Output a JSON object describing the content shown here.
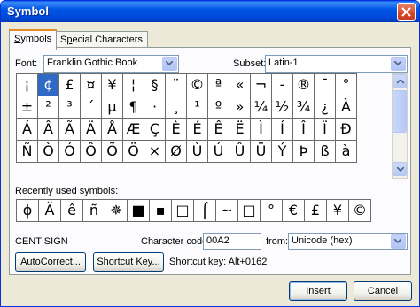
{
  "window": {
    "title": "Symbol"
  },
  "tabs": [
    {
      "label": "Symbols",
      "accel": "S",
      "rest": "ymbols"
    },
    {
      "label": "Special Characters",
      "pre": "S",
      "accel": "p",
      "rest": "ecial Characters"
    }
  ],
  "font": {
    "label": "Font:",
    "value": "Franklin Gothic Book"
  },
  "subset": {
    "label": "Subset:",
    "value": "Latin-1"
  },
  "symbols": [
    [
      "¡",
      "¢",
      "£",
      "¤",
      "¥",
      "¦",
      "§",
      "¨",
      "©",
      "ª",
      "«",
      "¬",
      "-",
      "®",
      "¯",
      "°"
    ],
    [
      "±",
      "²",
      "³",
      "´",
      "µ",
      "¶",
      "·",
      "¸",
      "¹",
      "º",
      "»",
      "¼",
      "½",
      "¾",
      "¿",
      "À"
    ],
    [
      "Á",
      "Â",
      "Ã",
      "Ä",
      "Å",
      "Æ",
      "Ç",
      "È",
      "É",
      "Ê",
      "Ë",
      "Ì",
      "Í",
      "Î",
      "Ï",
      "Ð"
    ],
    [
      "Ñ",
      "Ò",
      "Ó",
      "Ô",
      "Õ",
      "Ö",
      "×",
      "Ø",
      "Ù",
      "Ú",
      "Û",
      "Ü",
      "Ý",
      "Þ",
      "ß",
      "à"
    ]
  ],
  "selected_symbol": "¢",
  "recent": {
    "label": "Recently used symbols:",
    "items": [
      "ɸ",
      "Ă",
      "ê",
      "ñ",
      "✵",
      "■",
      "▪",
      "□",
      "⌠",
      "~",
      "□",
      "°",
      "€",
      "£",
      "¥",
      "©"
    ]
  },
  "char_name": "CENT SIGN",
  "char_code": {
    "label": "Character code:",
    "value": "00A2"
  },
  "from": {
    "label": "from:",
    "value": "Unicode (hex)"
  },
  "buttons": {
    "autocorrect": "AutoCorrect...",
    "shortcut_key": "Shortcut Key...",
    "insert": "Insert",
    "cancel": "Cancel"
  },
  "shortcut_text": "Shortcut key: Alt+0162",
  "colors": {
    "titlebar": "#0055e5",
    "selection": "#316ac5",
    "dialog_bg": "#ece9d8"
  },
  "icons": {
    "close": "close-icon",
    "dropdown": "chevron-down-icon",
    "scroll_up": "arrow-up-icon",
    "scroll_down": "arrow-down-icon"
  }
}
